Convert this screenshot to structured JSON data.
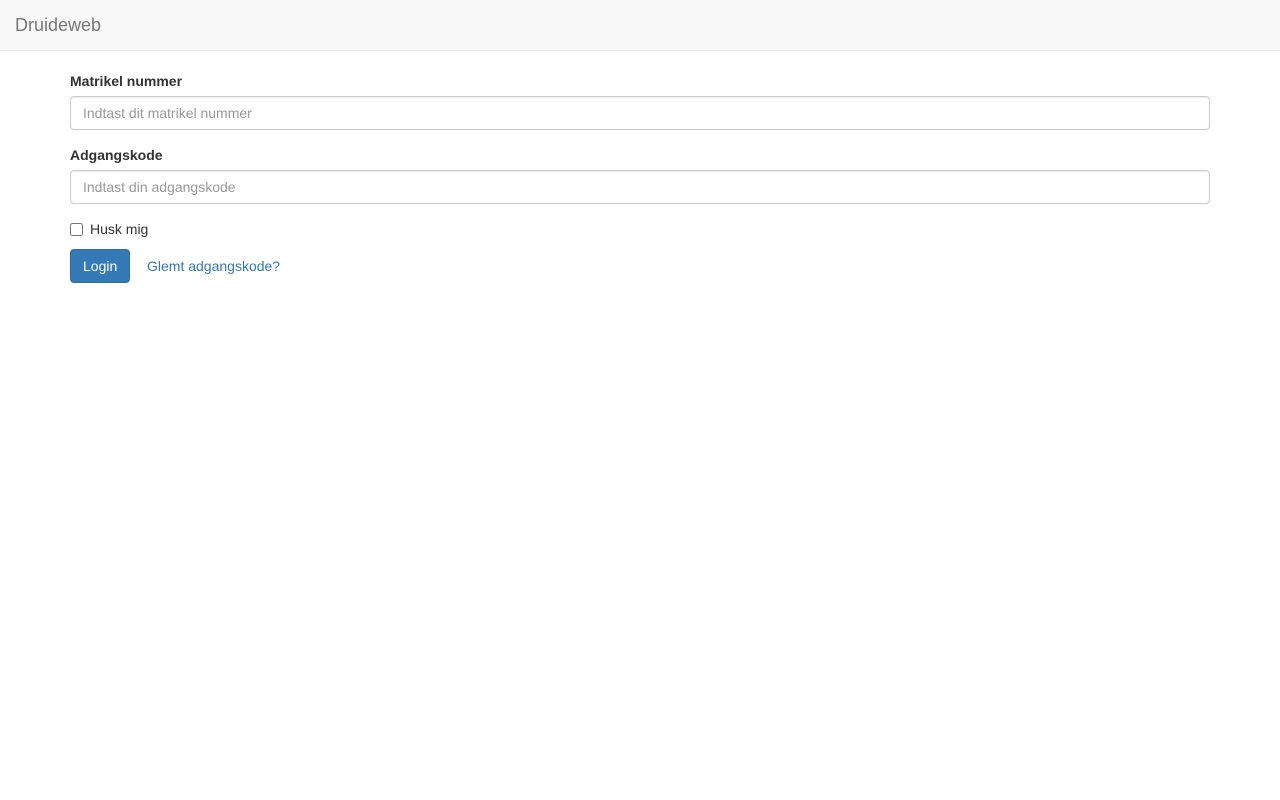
{
  "navbar": {
    "brand": "Druideweb"
  },
  "form": {
    "student_number": {
      "label": "Matrikel nummer",
      "value": "",
      "placeholder": "Indtast dit matrikel nummer"
    },
    "password": {
      "label": "Adgangskode",
      "value": "",
      "placeholder": "Indtast din adgangskode"
    },
    "remember_me": {
      "label": "Husk mig",
      "checked": false
    },
    "login_label": "Login",
    "forgot_password_label": "Glemt adgangskode?"
  },
  "colors": {
    "navbar_bg": "#f8f8f8",
    "brand_text": "#777777",
    "primary": "#337ab7",
    "input_border": "#cccccc",
    "placeholder": "#999999"
  }
}
